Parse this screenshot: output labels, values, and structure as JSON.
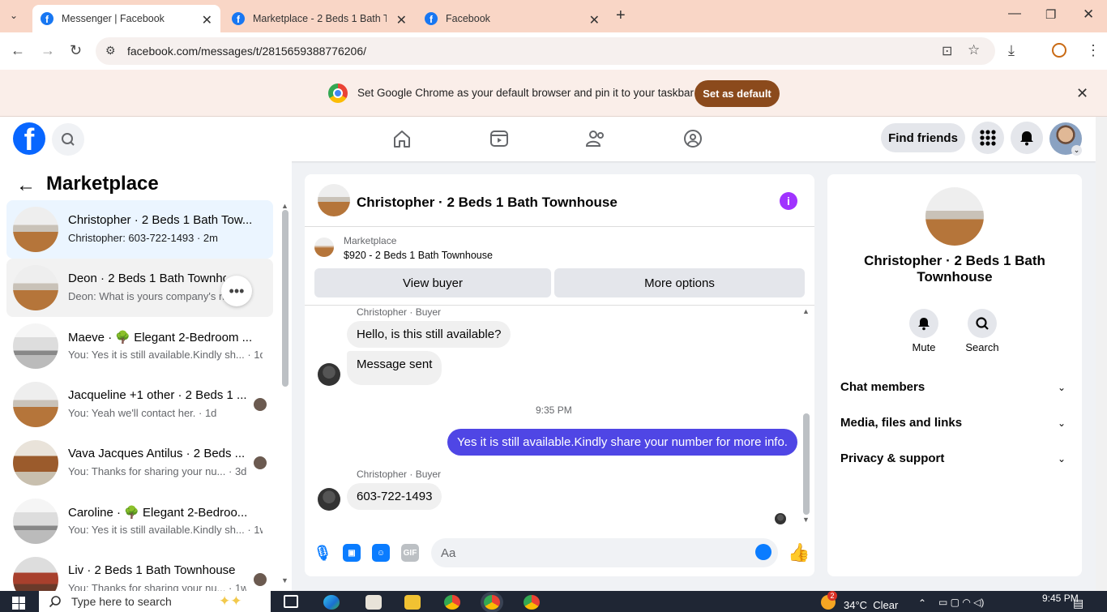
{
  "browser": {
    "tabs": [
      {
        "title": "Messenger | Facebook",
        "active": true
      },
      {
        "title": "Marketplace - 2 Beds 1 Bath To",
        "active": false
      },
      {
        "title": "Facebook",
        "active": false
      }
    ],
    "url": "facebook.com/messages/t/2815659388776206/",
    "infobar_text": "Set Google Chrome as your default browser and pin it to your taskbar",
    "set_default_label": "Set as default"
  },
  "facebook": {
    "find_friends": "Find friends",
    "accent": "#0866ff"
  },
  "sidebar": {
    "title": "Marketplace",
    "conversations": [
      {
        "title": "Christopher · 2 Beds 1 Bath Tow...",
        "sub": "Christopher: 603-722-1493 · 2m"
      },
      {
        "title": "Deon · 2 Beds 1 Bath Townho",
        "sub": "Deon: What is yours company's na        d"
      },
      {
        "title": "Maeve · 🌳 Elegant 2-Bedroom ...",
        "sub": "You: Yes it is still available.Kindly sh... · 1d"
      },
      {
        "title": "Jacqueline +1 other · 2 Beds 1 ...",
        "sub": "You: Yeah we'll contact her. · 1d"
      },
      {
        "title": "Vava Jacques Antilus · 2 Beds ...",
        "sub": "You: Thanks for sharing your nu... · 3d"
      },
      {
        "title": "Caroline · 🌳 Elegant 2-Bedroo...",
        "sub": "You: Yes it is still available.Kindly sh... · 1w"
      },
      {
        "title": "Liv · 2 Beds 1 Bath Townhouse",
        "sub": "You: Thanks for sharing your nu... · 1w"
      }
    ]
  },
  "chat": {
    "title": "Christopher · 2 Beds 1 Bath Townhouse",
    "marketplace_label": "Marketplace",
    "listing": "$920 - 2 Beds 1 Bath Townhouse",
    "view_buyer": "View buyer",
    "more_options": "More options",
    "sender1": "Christopher · Buyer",
    "msg1": "Hello, is this still available?",
    "msg2": "Message sent",
    "time": "9:35 PM",
    "msg3": "Yes it is still available.Kindly share your number for more info.",
    "sender2": "Christopher · Buyer",
    "msg4": "603-722-1493",
    "composer_placeholder": "Aa",
    "gif": "GIF",
    "my_bubble_color": "#4f46e5"
  },
  "details": {
    "name": "Christopher · 2 Beds 1 Bath Townhouse",
    "mute": "Mute",
    "search": "Search",
    "sections": [
      "Chat members",
      "Media, files and links",
      "Privacy & support"
    ]
  },
  "taskbar": {
    "search_placeholder": "Type here to search",
    "temp": "34°C",
    "weather": "Clear",
    "time": "9:45 PM",
    "weather_badge": "2"
  }
}
